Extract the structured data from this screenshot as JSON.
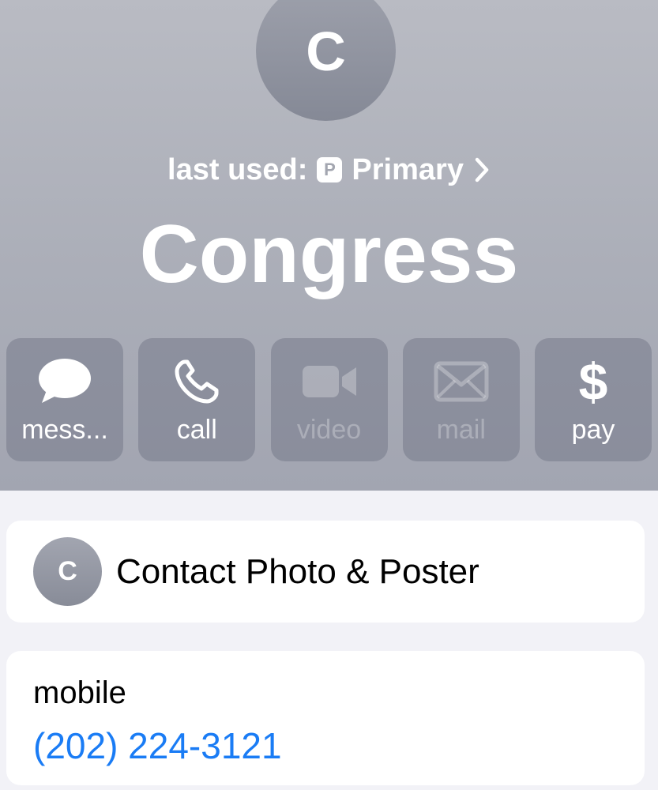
{
  "contact": {
    "initial": "C",
    "name": "Congress"
  },
  "last_used": {
    "prefix": "last used:",
    "sim_badge": "P",
    "line_name": "Primary",
    "chevron_icon": "chevron-right-icon"
  },
  "actions": [
    {
      "label": "mess...",
      "icon": "message-bubble-icon",
      "enabled": true
    },
    {
      "label": "call",
      "icon": "phone-icon",
      "enabled": true
    },
    {
      "label": "video",
      "icon": "video-camera-icon",
      "enabled": false
    },
    {
      "label": "mail",
      "icon": "envelope-icon",
      "enabled": false
    },
    {
      "label": "pay",
      "icon": "dollar-icon",
      "enabled": true
    }
  ],
  "photo_poster": {
    "initial": "C",
    "label": "Contact Photo & Poster"
  },
  "phone": {
    "label": "mobile",
    "number": "(202) 224-3121"
  },
  "colors": {
    "link": "#1a7cf5",
    "header_bg": "#abaeb8",
    "page_bg": "#f2f2f7"
  }
}
